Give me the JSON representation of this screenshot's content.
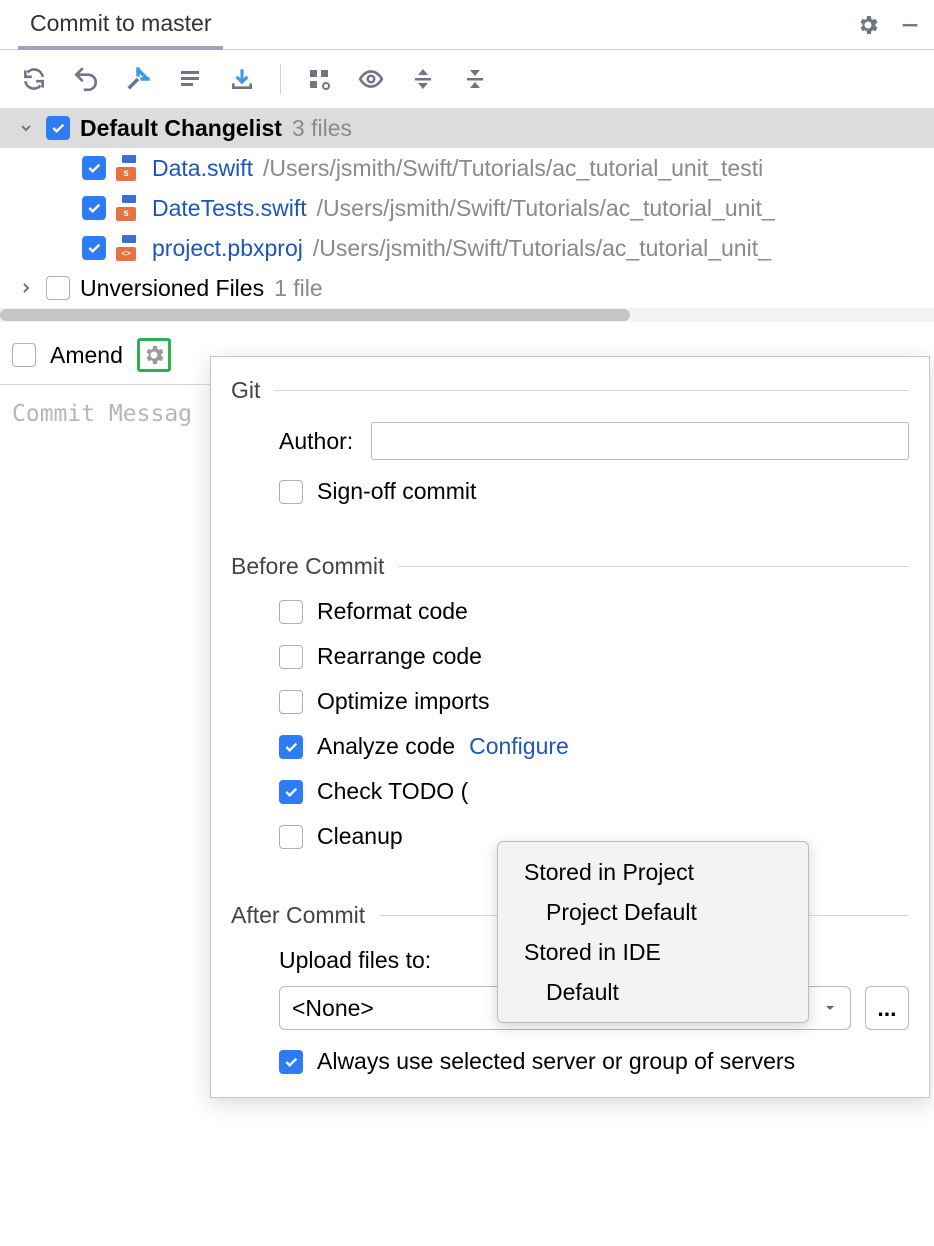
{
  "tab": {
    "title": "Commit to master"
  },
  "toolbar": {
    "refresh": "refresh",
    "rollback": "rollback",
    "jump": "jump",
    "changelist": "changelist",
    "shelve": "shelve",
    "group": "group",
    "preview": "preview",
    "expand": "expand",
    "collapse": "collapse"
  },
  "tree": {
    "default_changelist": {
      "label": "Default Changelist",
      "count_label": "3 files"
    },
    "files": [
      {
        "name": "Data.swift",
        "path": "/Users/jsmith/Swift/Tutorials/ac_tutorial_unit_testi",
        "badge": "s"
      },
      {
        "name": "DateTests.swift",
        "path": "/Users/jsmith/Swift/Tutorials/ac_tutorial_unit_",
        "badge": "s"
      },
      {
        "name": "project.pbxproj",
        "path": "/Users/jsmith/Swift/Tutorials/ac_tutorial_unit_",
        "badge": "<>"
      }
    ],
    "unversioned": {
      "label": "Unversioned Files",
      "count_label": "1 file"
    }
  },
  "amend": {
    "label": "Amend"
  },
  "commit_message": {
    "placeholder": "Commit Messag"
  },
  "popover": {
    "git": {
      "title": "Git",
      "author_label": "Author:",
      "author_value": "",
      "signoff_label": "Sign-off commit"
    },
    "before": {
      "title": "Before Commit",
      "reformat": "Reformat code",
      "rearrange": "Rearrange code",
      "optimize": "Optimize imports",
      "analyze": "Analyze code",
      "analyze_configure": "Configure",
      "check_todo": "Check TODO (",
      "cleanup": "Cleanup"
    },
    "after": {
      "title": "After Commit",
      "upload_label": "Upload files to:",
      "upload_value": "<None>",
      "ellipsis": "...",
      "always_use": "Always use selected server or group of servers"
    }
  },
  "submenu": {
    "item1": "Stored in Project",
    "item1b": "Project Default",
    "item2": "Stored in IDE",
    "item2b": "Default"
  }
}
